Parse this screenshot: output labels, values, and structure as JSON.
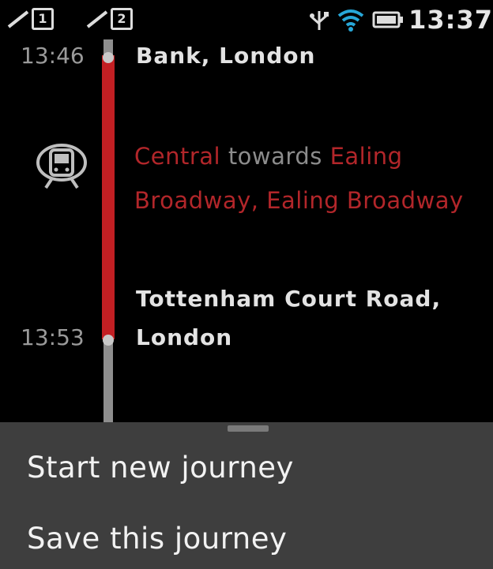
{
  "status_bar": {
    "sim1": "1",
    "sim2": "2",
    "time": "13:37"
  },
  "journey": {
    "stops": [
      {
        "time": "13:46",
        "name": "Bank, London"
      },
      {
        "time": "13:53",
        "name_line1": "Tottenham Court Road,",
        "name_line2": "London"
      }
    ],
    "leg": {
      "line": "Central",
      "towards_word": "towards",
      "destination": "Ealing Broadway, Ealing Broadway"
    },
    "line_color": "#c21f23",
    "mode_icon": "train-icon"
  },
  "menu": {
    "items": [
      {
        "label": "Start new journey"
      },
      {
        "label": "Save this journey"
      }
    ]
  }
}
